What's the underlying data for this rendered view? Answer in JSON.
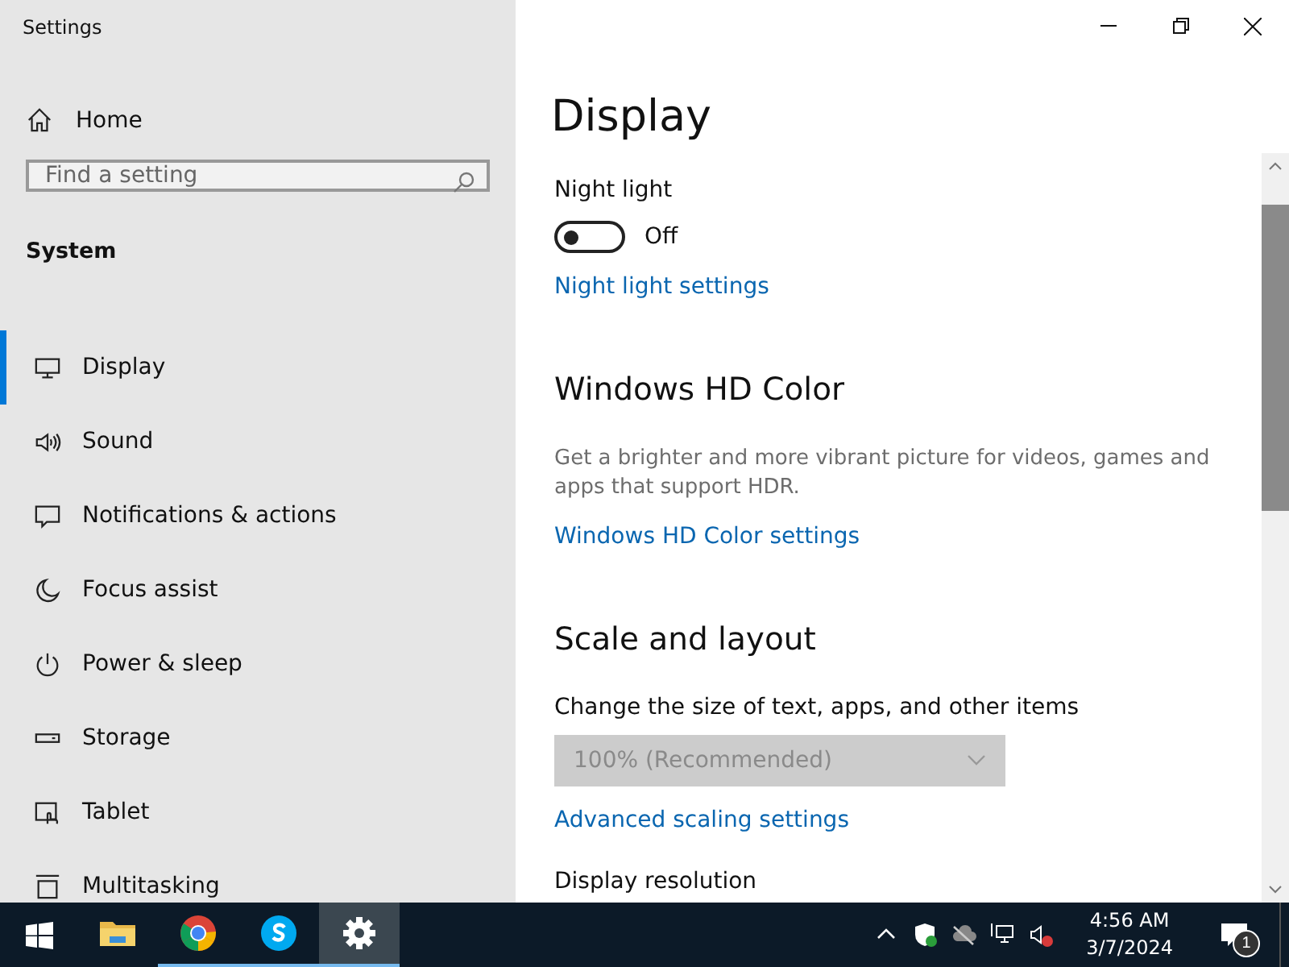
{
  "window": {
    "title": "Settings"
  },
  "sidebar": {
    "home": {
      "label": "Home"
    },
    "search": {
      "placeholder": "Find a setting"
    },
    "section": "System",
    "items": [
      {
        "label": "Display",
        "selected": true
      },
      {
        "label": "Sound",
        "selected": false
      },
      {
        "label": "Notifications & actions",
        "selected": false
      },
      {
        "label": "Focus assist",
        "selected": false
      },
      {
        "label": "Power & sleep",
        "selected": false
      },
      {
        "label": "Storage",
        "selected": false
      },
      {
        "label": "Tablet",
        "selected": false
      },
      {
        "label": "Multitasking",
        "selected": false
      }
    ]
  },
  "page": {
    "title": "Display",
    "blocks": [
      {
        "kind": "label",
        "text": "Night light"
      },
      {
        "kind": "toggle",
        "on": false,
        "state_label": "Off"
      },
      {
        "kind": "link",
        "text": "Night light settings"
      },
      {
        "kind": "heading",
        "text": "Windows HD Color"
      },
      {
        "kind": "description",
        "text": "Get a brighter and more vibrant picture for videos, games and apps that support HDR."
      },
      {
        "kind": "link",
        "text": "Windows HD Color settings"
      },
      {
        "kind": "heading",
        "text": "Scale and layout"
      },
      {
        "kind": "label",
        "text": "Change the size of text, apps, and other items"
      },
      {
        "kind": "dropdown",
        "value": "100% (Recommended)",
        "disabled": true
      },
      {
        "kind": "link",
        "text": "Advanced scaling settings"
      },
      {
        "kind": "label",
        "text": "Display resolution"
      }
    ]
  },
  "taskbar": {
    "apps": [
      {
        "kind": "folder",
        "running": false,
        "selected": false
      },
      {
        "kind": "browser",
        "running": true,
        "selected": false
      },
      {
        "kind": "chat",
        "running": true,
        "selected": false
      },
      {
        "kind": "settings",
        "running": true,
        "selected": true
      }
    ],
    "time": "4:56 AM",
    "date": "3/7/2024",
    "notification_count": "1"
  }
}
